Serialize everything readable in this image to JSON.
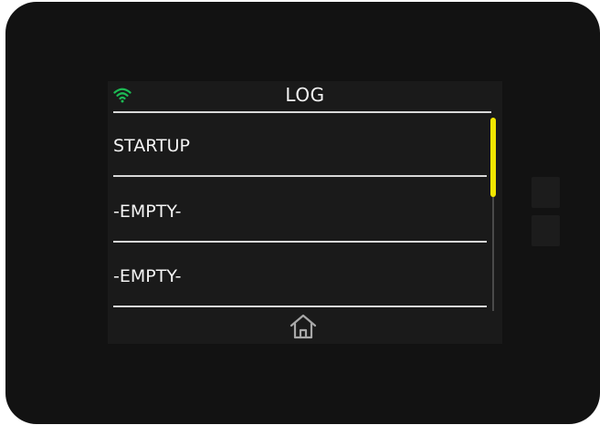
{
  "screen": {
    "title": "LOG",
    "wifi_icon": "wifi-icon",
    "wifi_color": "#1db954",
    "scrollbar_color": "#f2e600",
    "home_icon": "home-icon"
  },
  "log": {
    "items": [
      {
        "label": "STARTUP"
      },
      {
        "label": "-EMPTY-"
      },
      {
        "label": "-EMPTY-"
      }
    ]
  }
}
